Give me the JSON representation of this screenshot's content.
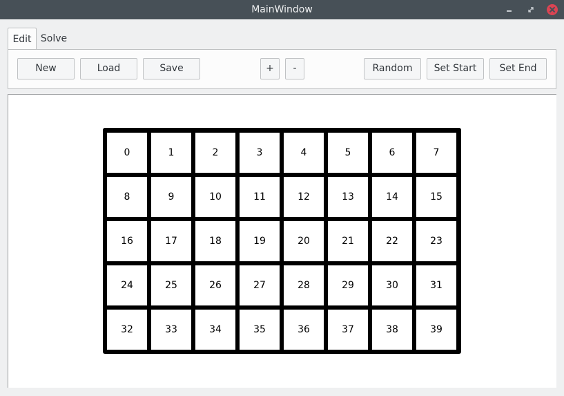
{
  "window": {
    "title": "MainWindow",
    "minimize_icon": "minimize-icon",
    "restore_icon": "restore-icon",
    "close_icon": "close-icon",
    "close_color": "#da4453"
  },
  "tabs": [
    {
      "label": "Edit",
      "active": true
    },
    {
      "label": "Solve",
      "active": false
    }
  ],
  "toolbar": {
    "new_label": "New",
    "load_label": "Load",
    "save_label": "Save",
    "plus_label": "+",
    "minus_label": "-",
    "random_label": "Random",
    "set_start_label": "Set Start",
    "set_end_label": "Set End"
  },
  "grid": {
    "rows": 5,
    "cols": 8,
    "cells": [
      "0",
      "1",
      "2",
      "3",
      "4",
      "5",
      "6",
      "7",
      "8",
      "9",
      "10",
      "11",
      "12",
      "13",
      "14",
      "15",
      "16",
      "17",
      "18",
      "19",
      "20",
      "21",
      "22",
      "23",
      "24",
      "25",
      "26",
      "27",
      "28",
      "29",
      "30",
      "31",
      "32",
      "33",
      "34",
      "35",
      "36",
      "37",
      "38",
      "39"
    ]
  }
}
